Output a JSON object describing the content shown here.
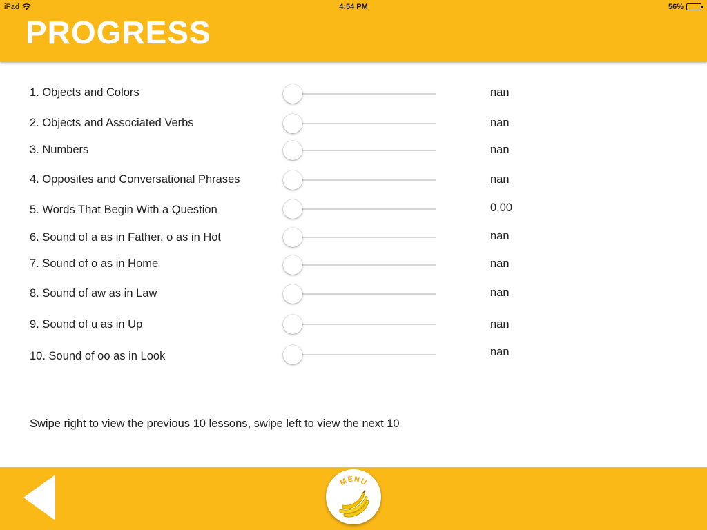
{
  "status_bar": {
    "device": "iPad",
    "time": "4:54 PM",
    "battery": "56%",
    "battery_level": 0.56
  },
  "header": {
    "title": "PROGRESS"
  },
  "lessons": [
    {
      "label": "1. Objects and Colors",
      "score": "nan",
      "progress": 0
    },
    {
      "label": "2. Objects and Associated Verbs",
      "score": "nan",
      "progress": 0
    },
    {
      "label": "3. Numbers",
      "score": "nan",
      "progress": 0
    },
    {
      "label": "4. Opposites and Conversational Phrases",
      "score": "nan",
      "progress": 0
    },
    {
      "label": "5. Words That Begin With a Question",
      "score": "0.00",
      "progress": 0
    },
    {
      "label": "6. Sound of a as in Father, o as in Hot",
      "score": "nan",
      "progress": 0
    },
    {
      "label": "7. Sound of o as in Home",
      "score": "nan",
      "progress": 0
    },
    {
      "label": "8. Sound of aw as in Law",
      "score": "nan",
      "progress": 0
    },
    {
      "label": "9. Sound of u as in Up",
      "score": "nan",
      "progress": 0
    },
    {
      "label": "10. Sound of oo as in Look",
      "score": "nan",
      "progress": 0
    }
  ],
  "hint": "Swipe right to view the previous 10 lessons, swipe left to view the next 10",
  "footer": {
    "back_icon": "triangle-left-icon",
    "menu_label": "MENU",
    "menu_icon": "banana-icon"
  },
  "colors": {
    "accent": "#FBB917",
    "header_text": "#FFFFFF",
    "body_text": "#222222",
    "menu_text": "#F5A800"
  }
}
